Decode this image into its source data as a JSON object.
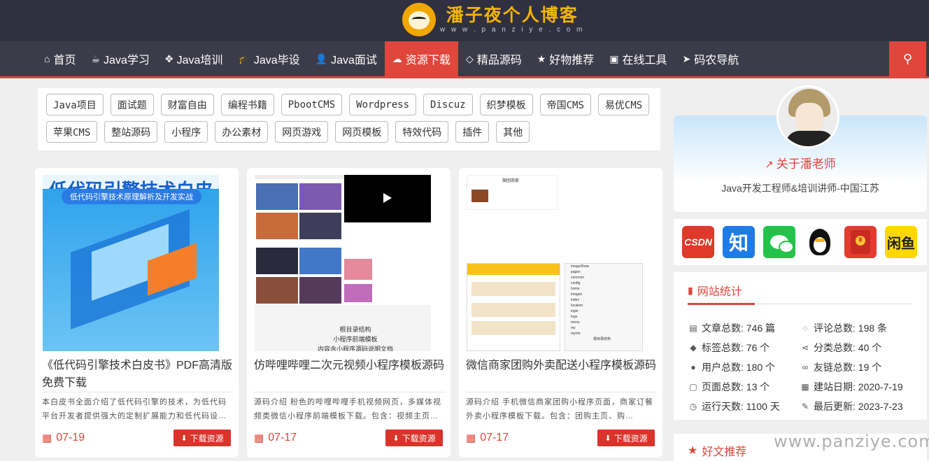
{
  "header": {
    "site_title": "潘子夜个人博客",
    "site_sub": "w w w . p a n z i y e . c o m"
  },
  "nav": {
    "items": [
      {
        "label": "首页",
        "icon": "home-icon"
      },
      {
        "label": "Java学习",
        "icon": "coffee-icon"
      },
      {
        "label": "Java培训",
        "icon": "crosshair-icon"
      },
      {
        "label": "Java毕设",
        "icon": "graduation-cap-icon"
      },
      {
        "label": "Java面试",
        "icon": "user-icon"
      },
      {
        "label": "资源下载",
        "icon": "cloud-download-icon",
        "active": true
      },
      {
        "label": "精品源码",
        "icon": "diamond-icon"
      },
      {
        "label": "好物推荐",
        "icon": "star-icon"
      },
      {
        "label": "在线工具",
        "icon": "briefcase-icon"
      },
      {
        "label": "码农导航",
        "icon": "paper-plane-icon"
      }
    ],
    "search_icon": "search-icon"
  },
  "tags": [
    "Java项目",
    "面试题",
    "财富自由",
    "编程书籍",
    "PbootCMS",
    "Wordpress",
    "Discuz",
    "织梦模板",
    "帝国CMS",
    "易优CMS",
    "苹果CMS",
    "整站源码",
    "小程序",
    "办公素材",
    "网页游戏",
    "网页模板",
    "特效代码",
    "插件",
    "其他"
  ],
  "cards": [
    {
      "thumb_title": "低代码引擎技术白皮书",
      "thumb_pill": "低代码引擎技术原理解析及开发实战",
      "title": "《低代码引擎技术白皮书》PDF高清版免费下载",
      "desc": "本白皮书全面介绍了低代码引擎的技术，为低代码平台开发者提供强大的定制扩展能力和低代码设…",
      "date": "07-19",
      "download": "下载资源"
    },
    {
      "thumb_caption": [
        "根目录结构",
        "小程序前端模板",
        "内容含小程序源码说明文档"
      ],
      "title": "仿哔哩哔哩二次元视频小程序模板源码",
      "desc": "源码介绍 粉色的哔哩哔哩手机视频网页，多媒体视频类微信小程序前端模板下载。包含：视频主页…",
      "date": "07-17",
      "download": "下载资源"
    },
    {
      "thumb_header": "微团商家",
      "thumb_tree": [
        "imageShow",
        "pages",
        "common",
        "config",
        "home",
        "images",
        "index",
        "location",
        "login",
        "logs",
        "menu",
        "my",
        "mynfo"
      ],
      "thumb_tree_caption": "根目录结构",
      "title": "微信商家团购外卖配送小程序模板源码",
      "desc": "源码介绍 手机微信商家团购小程序页面，商家订餐外卖小程序模板下载。包含：团购主页、购…",
      "date": "07-17",
      "download": "下载资源"
    }
  ],
  "profile": {
    "about_label": "关于潘老师",
    "bio": "Java开发工程师&培训讲师-中国江苏"
  },
  "social": {
    "csdn": "CSDN",
    "zhihu": "知",
    "xianyu": "闲鱼"
  },
  "stats": {
    "title": "网站统计",
    "items": [
      {
        "label": "文章总数: 746 篇",
        "icon": "file-text-icon"
      },
      {
        "label": "评论总数: 198 条",
        "icon": "comments-icon"
      },
      {
        "label": "标签总数: 76 个",
        "icon": "tag-icon"
      },
      {
        "label": "分类总数: 40 个",
        "icon": "share-icon"
      },
      {
        "label": "用户总数: 180 个",
        "icon": "users-icon"
      },
      {
        "label": "友链总数: 19 个",
        "icon": "link-icon"
      },
      {
        "label": "页面总数: 13 个",
        "icon": "file-icon"
      },
      {
        "label": "建站日期: 2020-7-19",
        "icon": "calendar-icon"
      },
      {
        "label": "运行天数: 1100 天",
        "icon": "clock-icon"
      },
      {
        "label": "最后更新: 2023-7-23",
        "icon": "edit-icon"
      }
    ]
  },
  "recommend": {
    "title": "好文推荐"
  },
  "watermark": "www.panziye.com",
  "colors": {
    "accent": "#e0463c",
    "header_bg": "#303040",
    "nav_bg": "#3b3b49"
  }
}
